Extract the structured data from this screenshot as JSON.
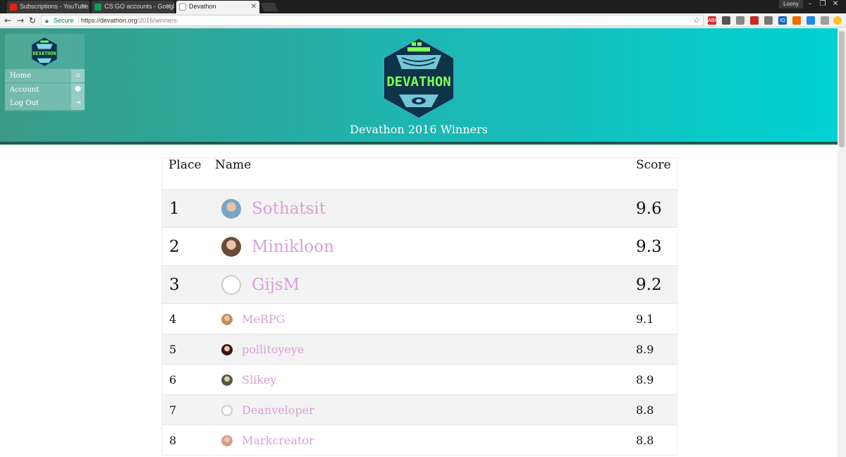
{
  "browser": {
    "tabs": [
      {
        "title": "Subscriptions - YouTube",
        "favicon_color": "#e62117",
        "active": false
      },
      {
        "title": "CS:GO accounts - Google",
        "favicon_color": "#0f9d58",
        "active": false
      },
      {
        "title": "Devathon",
        "favicon_color": "#dddddd",
        "active": true
      }
    ],
    "profile_name": "Loony",
    "secure_label": "Secure",
    "url_host": "https://devathon.org",
    "url_path": "/2016/winners"
  },
  "sidebar": {
    "logo_text": "DEVATHON",
    "items": [
      {
        "label": "Home",
        "icon": "home-icon"
      },
      {
        "label": "Account",
        "icon": "user-icon"
      },
      {
        "label": "Log Out",
        "icon": "logout-icon"
      }
    ]
  },
  "hero": {
    "logo_text": "DEVATHON",
    "title": "Devathon 2016 Winners"
  },
  "table": {
    "headers": {
      "place": "Place",
      "name": "Name",
      "score": "Score"
    },
    "rows": [
      {
        "place": "1",
        "name": "Sothatsit",
        "score": "9.6",
        "avatar": "photo",
        "color": "#7aa6c4"
      },
      {
        "place": "2",
        "name": "Minikloon",
        "score": "9.3",
        "avatar": "photo",
        "color": "#6b4a36"
      },
      {
        "place": "3",
        "name": "GijsM",
        "score": "9.2",
        "avatar": "github-icon",
        "color": "#cccccc"
      },
      {
        "place": "4",
        "name": "MeRPG",
        "score": "9.1",
        "avatar": "photo",
        "color": "#c48a5a"
      },
      {
        "place": "5",
        "name": "pollitoyeye",
        "score": "8.9",
        "avatar": "photo",
        "color": "#3a1414"
      },
      {
        "place": "6",
        "name": "Slikey",
        "score": "8.9",
        "avatar": "photo",
        "color": "#4a5a44"
      },
      {
        "place": "7",
        "name": "Deanveloper",
        "score": "8.8",
        "avatar": "github-icon",
        "color": "#cccccc"
      },
      {
        "place": "8",
        "name": "Markcreator",
        "score": "8.8",
        "avatar": "photo",
        "color": "#d0a090"
      }
    ]
  },
  "colors": {
    "name_link": "#d9a0d9",
    "hero_left": "#3a9a86",
    "hero_right": "#00d2d2",
    "logo_green": "#7dff5a",
    "logo_dark": "#0d3448"
  }
}
